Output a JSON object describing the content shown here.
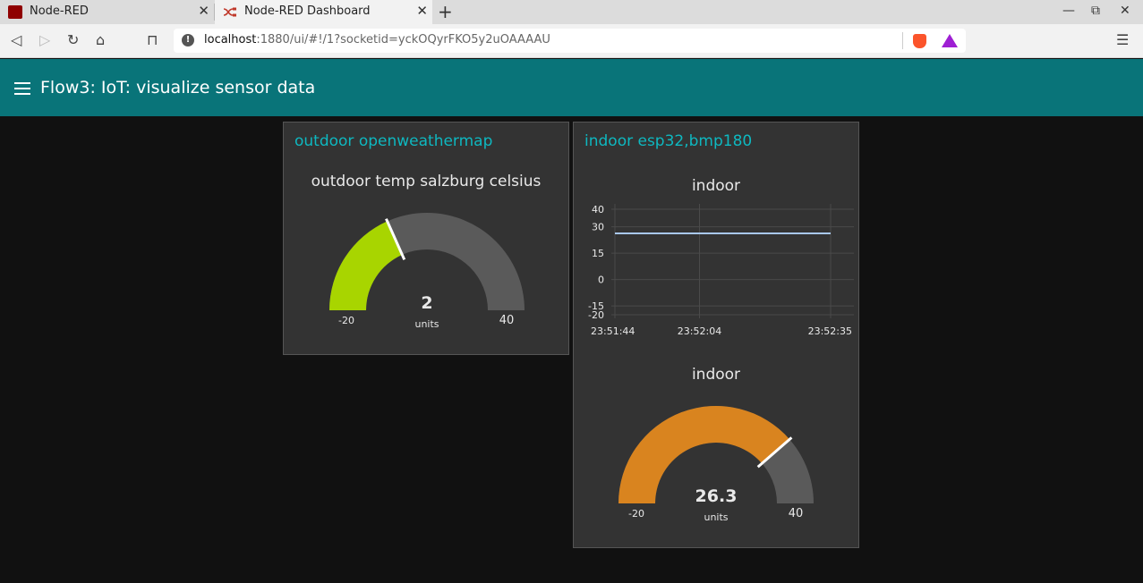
{
  "browser": {
    "tabs": [
      {
        "title": "Node-RED",
        "active": false
      },
      {
        "title": "Node-RED Dashboard",
        "active": true
      }
    ],
    "url_host": "localhost",
    "url_rest": ":1880/ui/#!/1?socketid=yckOQyrFKO5y2uOAAAAU"
  },
  "dashboard": {
    "title": "Flow3: IoT: visualize sensor data",
    "header_color": "#097479"
  },
  "groups": {
    "outdoor": {
      "title": "outdoor openweathermap",
      "gauge": {
        "title": "outdoor temp salzburg celsius",
        "value": "2",
        "units": "units",
        "min": "-20",
        "max": "40",
        "fill_color": "#a8d500"
      }
    },
    "indoor": {
      "title": "indoor esp32,bmp180",
      "chart_title": "indoor",
      "gauge": {
        "title": "indoor",
        "value": "26.3",
        "units": "units",
        "min": "-20",
        "max": "40",
        "fill_color": "#d9841f"
      }
    }
  },
  "chart_data": {
    "type": "line",
    "title": "indoor",
    "x": [
      "23:51:44",
      "23:52:35"
    ],
    "x_ticks": [
      "23:51:44",
      "23:52:04",
      "23:52:35"
    ],
    "y_ticks": [
      "40",
      "30",
      "15",
      "0",
      "-15",
      "-20"
    ],
    "ylim": [
      -20,
      40
    ],
    "series": [
      {
        "values": [
          26.3,
          26.3
        ],
        "color": "#a9c8f0"
      }
    ]
  }
}
